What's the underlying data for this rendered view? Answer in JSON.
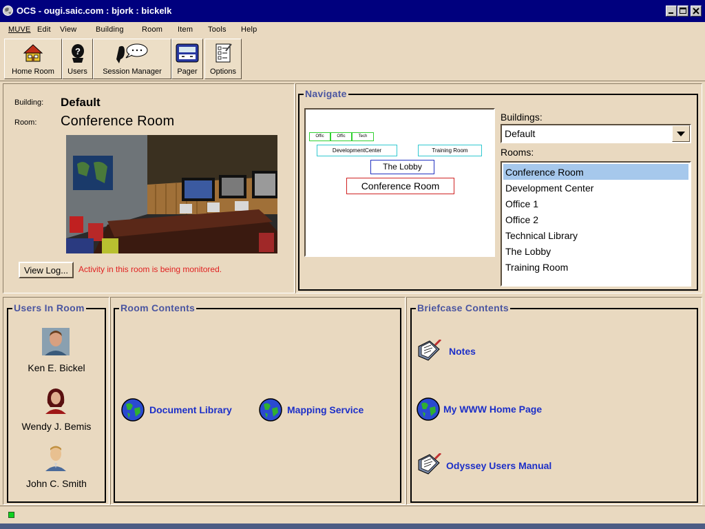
{
  "window": {
    "title": "OCS - ougi.saic.com : bjork : bickelk"
  },
  "menu": [
    {
      "label": "MUVE",
      "mnemonic": "M"
    },
    {
      "label": "Edit",
      "mnemonic": "E"
    },
    {
      "label": "View",
      "mnemonic": "V"
    },
    {
      "label": "Building",
      "mnemonic": "B"
    },
    {
      "label": "Room",
      "mnemonic": "R"
    },
    {
      "label": "Item",
      "mnemonic": "I"
    },
    {
      "label": "Tools",
      "mnemonic": "T"
    },
    {
      "label": "Help",
      "mnemonic": "H"
    }
  ],
  "toolbar": [
    {
      "label": "Home Room",
      "icon": "house-icon"
    },
    {
      "label": "Users",
      "icon": "user-help-icon"
    },
    {
      "label": "Session Manager",
      "icon": "speech-bubble-icon"
    },
    {
      "label": "Pager",
      "icon": "pager-icon"
    },
    {
      "label": "Options",
      "icon": "checklist-icon"
    }
  ],
  "room_info": {
    "building_label": "Building:",
    "building": "Default",
    "room_label": "Room:",
    "room": "Conference Room",
    "view_log_label": "View Log...",
    "monitor_text": "Activity in this room is being monitored."
  },
  "navigate": {
    "title": "Navigate",
    "map_rooms": [
      "Offic",
      "Offic",
      "Tech",
      "DevelopmentCenter",
      "Training Room",
      "The Lobby",
      "Conference Room"
    ],
    "buildings_label": "Buildings:",
    "building_selected": "Default",
    "rooms_label": "Rooms:",
    "rooms": [
      "Conference Room",
      "Development Center",
      "Office 1",
      "Office 2",
      "Technical Library",
      "The Lobby",
      "Training Room"
    ],
    "selected_room": "Conference Room"
  },
  "users_in_room": {
    "title": "Users In Room",
    "users": [
      "Ken E. Bickel",
      "Wendy J. Bemis",
      "John C. Smith"
    ]
  },
  "room_contents": {
    "title": "Room Contents",
    "items": [
      "Document Library",
      "Mapping Service"
    ]
  },
  "briefcase": {
    "title": "Briefcase Contents",
    "items": [
      "Notes",
      "My WWW Home Page",
      "Odyssey Users Manual"
    ]
  },
  "colors": {
    "titlebar": "#00007e",
    "background": "#e9d9c0",
    "group_title": "#4a55a0",
    "link": "#1c2fc8",
    "warning": "#e02020",
    "selection": "#a6c8ec"
  }
}
